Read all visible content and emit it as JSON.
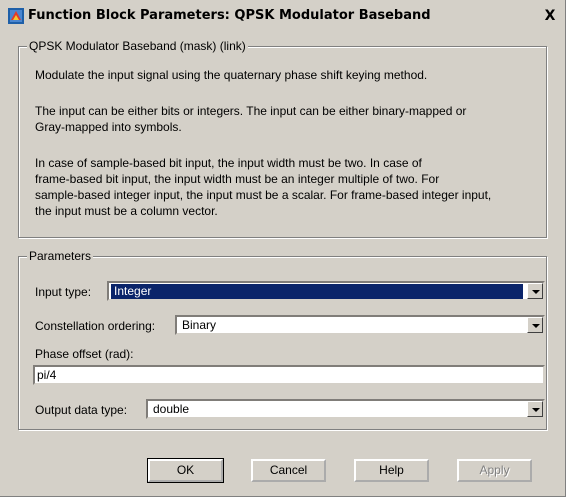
{
  "window": {
    "title": "Function Block Parameters: QPSK Modulator Baseband",
    "close_label": "X"
  },
  "mask": {
    "legend": "QPSK Modulator Baseband (mask) (link)",
    "lines": [
      "Modulate the input signal using the quaternary phase shift keying method.",
      "The input can be either bits or integers. The input can be either binary-mapped or",
      "Gray-mapped into symbols.",
      "In case of sample-based bit input, the input width must be two. In case of",
      "frame-based bit input, the input width must be an integer multiple of two. For",
      "sample-based integer input, the input must be a scalar. For frame-based integer input,",
      "the input must be a column vector."
    ]
  },
  "params": {
    "legend": "Parameters",
    "input_type": {
      "label": "Input type:",
      "value": "Integer"
    },
    "constellation": {
      "label": "Constellation ordering:",
      "value": "Binary"
    },
    "phase_offset": {
      "label": "Phase offset (rad):",
      "value": "pi/4"
    },
    "output_type": {
      "label": "Output data type:",
      "value": "double"
    }
  },
  "buttons": {
    "ok": "OK",
    "cancel": "Cancel",
    "help": "Help",
    "apply": "Apply"
  },
  "icons": {
    "title_icon": "simulink-block-icon",
    "dropdown": "chevron-down-icon"
  }
}
